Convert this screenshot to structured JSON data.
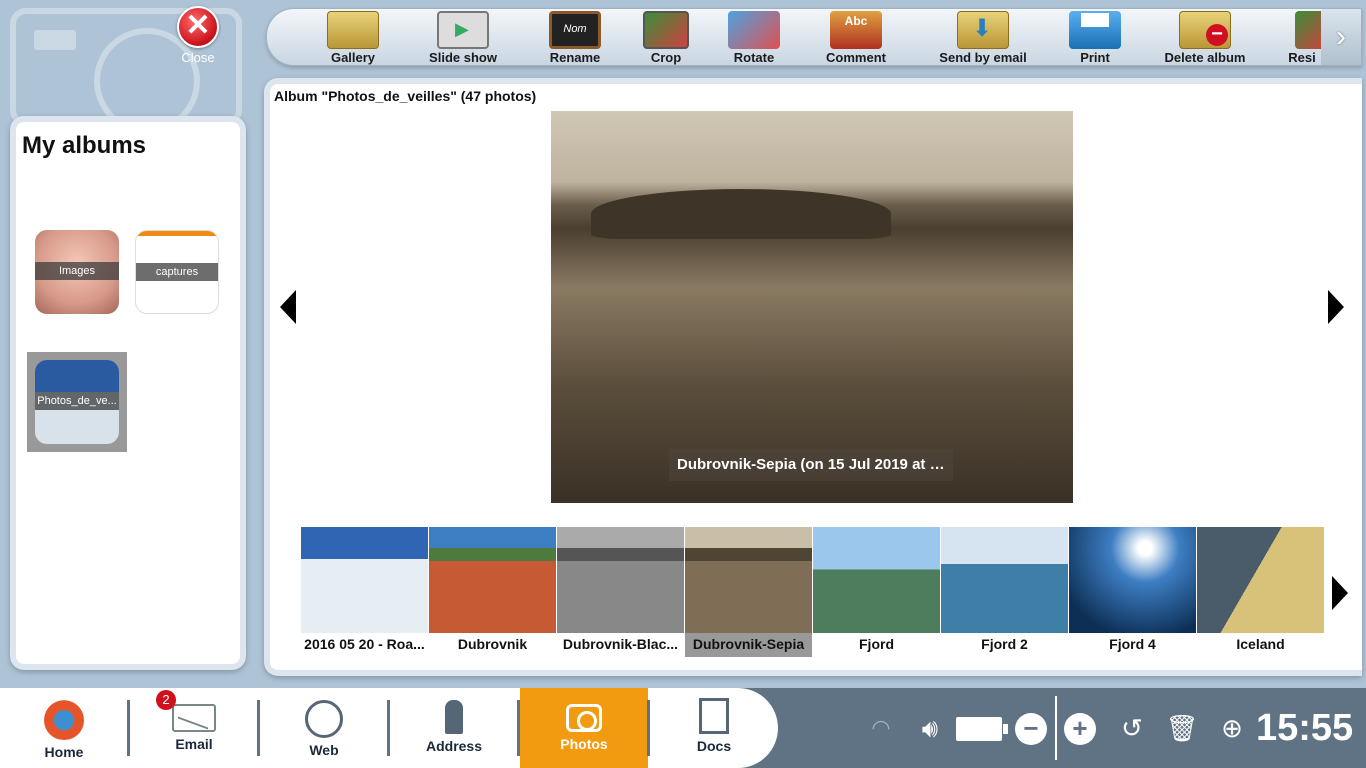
{
  "close_label": "Close",
  "toolbar": {
    "items": [
      {
        "label": "Gallery",
        "icon": "gallery-icon"
      },
      {
        "label": "Slide show",
        "icon": "slideshow-icon"
      },
      {
        "label": "Rename",
        "icon": "rename-icon"
      },
      {
        "label": "Crop",
        "icon": "crop-icon"
      },
      {
        "label": "Rotate",
        "icon": "rotate-icon"
      },
      {
        "label": "Comment",
        "icon": "comment-icon"
      },
      {
        "label": "Send by email",
        "icon": "send-email-icon"
      },
      {
        "label": "Print",
        "icon": "print-icon"
      },
      {
        "label": "Delete album",
        "icon": "delete-album-icon"
      },
      {
        "label": "Resi",
        "icon": "resize-icon"
      }
    ],
    "rename_icon_text": "Nom",
    "comment_icon_text": "Abc",
    "next_glyph": "›"
  },
  "albums": {
    "title": "My albums",
    "items": [
      {
        "label": "Images"
      },
      {
        "label": "captures"
      },
      {
        "label": "Photos_de_ve..."
      }
    ]
  },
  "main": {
    "header": "Album \"Photos_de_veilles\" (47 photos)",
    "caption": "Dubrovnik-Sepia (on 15 Jul 2019 at 1...",
    "thumbnails": [
      {
        "name": "2016 05 20 - Roa..."
      },
      {
        "name": "Dubrovnik"
      },
      {
        "name": "Dubrovnik-Blac..."
      },
      {
        "name": "Dubrovnik-Sepia"
      },
      {
        "name": "Fjord"
      },
      {
        "name": "Fjord 2"
      },
      {
        "name": "Fjord 4"
      },
      {
        "name": "Iceland"
      }
    ],
    "selected_index": 3
  },
  "taskbar": {
    "apps": [
      {
        "label": "Home"
      },
      {
        "label": "Email",
        "badge": "2"
      },
      {
        "label": "Web"
      },
      {
        "label": "Address"
      },
      {
        "label": "Photos"
      },
      {
        "label": "Docs"
      }
    ],
    "active_app": "Photos",
    "volume_down": "−",
    "volume_up": "+",
    "clock": "15:55"
  },
  "colors": {
    "accent": "#f39b10",
    "taskbar": "#5f7385",
    "close_red": "#c8101a"
  }
}
